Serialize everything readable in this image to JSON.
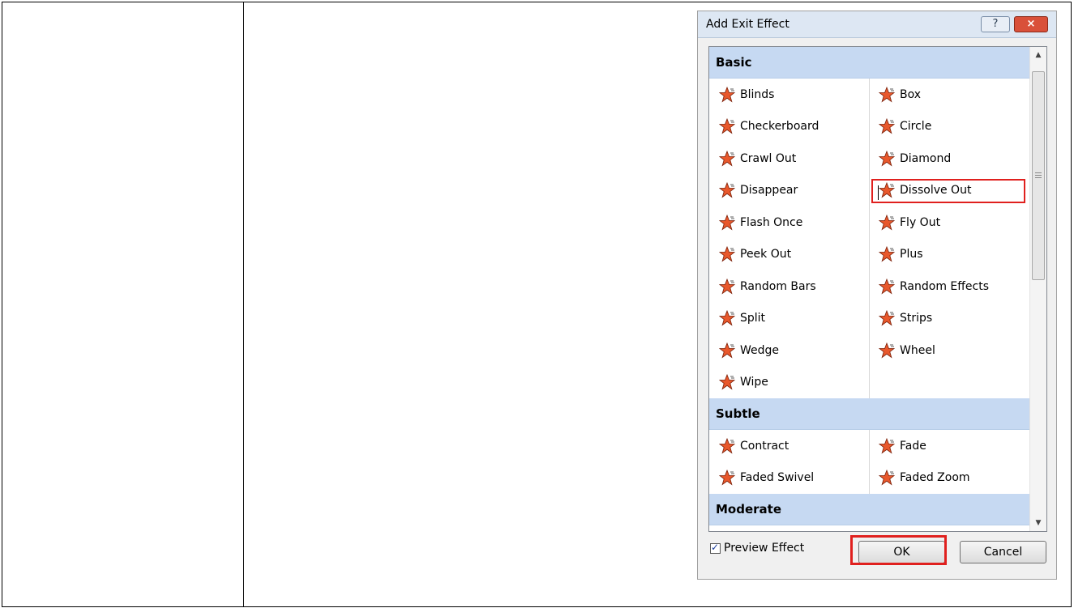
{
  "dialog": {
    "title": "Add Exit Effect",
    "help_glyph": "?",
    "close_glyph": "×",
    "help_icon": "help-icon",
    "close_icon": "close-icon"
  },
  "categories": [
    {
      "name": "Basic",
      "effects": [
        [
          "Blinds",
          "Box"
        ],
        [
          "Checkerboard",
          "Circle"
        ],
        [
          "Crawl Out",
          "Diamond"
        ],
        [
          "Disappear",
          "Dissolve Out"
        ],
        [
          "Flash Once",
          "Fly Out"
        ],
        [
          "Peek Out",
          "Plus"
        ],
        [
          "Random Bars",
          "Random Effects"
        ],
        [
          "Split",
          "Strips"
        ],
        [
          "Wedge",
          "Wheel"
        ],
        [
          "Wipe",
          ""
        ]
      ]
    },
    {
      "name": "Subtle",
      "effects": [
        [
          "Contract",
          "Fade"
        ],
        [
          "Faded Swivel",
          "Faded Zoom"
        ]
      ]
    },
    {
      "name": "Moderate",
      "effects": []
    }
  ],
  "selected_effect": "Dissolve Out",
  "footer": {
    "preview_label": "Preview Effect",
    "preview_checked": true,
    "ok_label": "OK",
    "cancel_label": "Cancel"
  },
  "colors": {
    "highlight": "#e0201e",
    "header_bg": "#c6d9f2",
    "star": "#e8582c"
  }
}
